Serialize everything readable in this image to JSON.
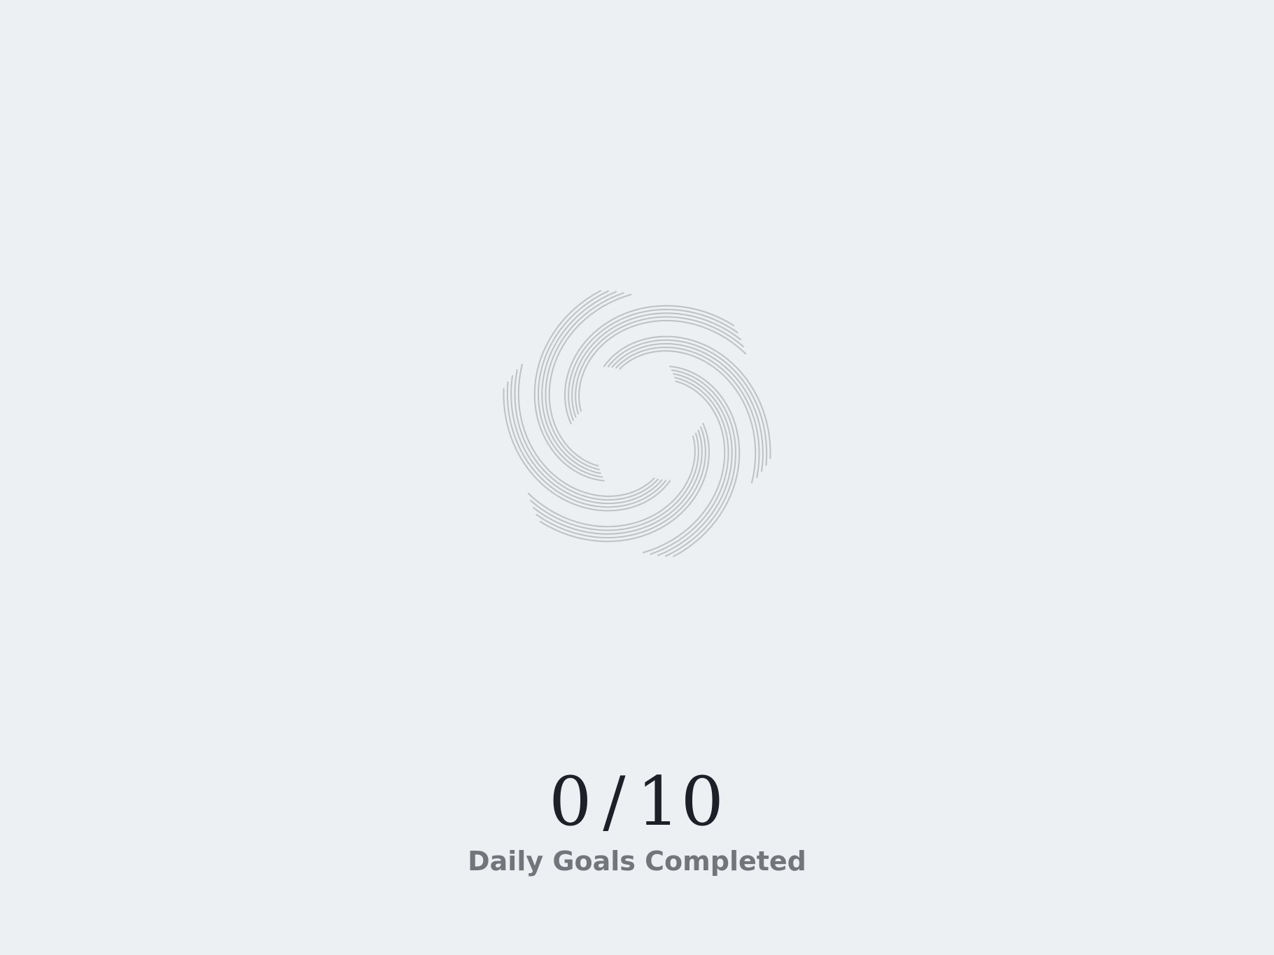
{
  "progress": {
    "completed": "0",
    "separator": "/",
    "total": "10",
    "caption": "Daily Goals Completed",
    "fraction_completed": 0
  },
  "icons": {
    "center": "swirl-ring-icon"
  },
  "colors": {
    "background": "#EDF0F3",
    "swirl_stroke": "#B9BCBF",
    "counter_text": "#1D2026",
    "caption_text": "#72767B"
  }
}
